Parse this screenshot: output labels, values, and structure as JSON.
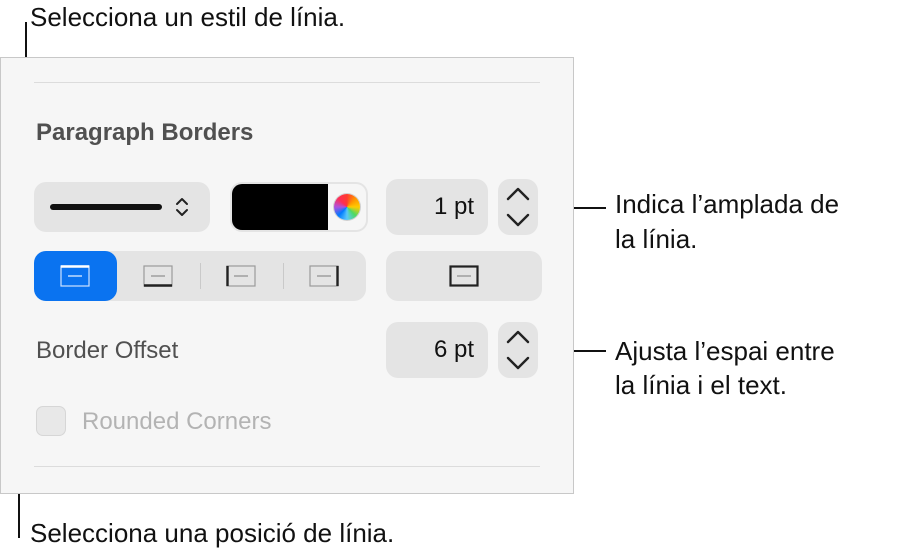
{
  "callouts": {
    "top": "Selecciona un estil de línia.",
    "width_line1": "Indica l’amplada de",
    "width_line2": "la línia.",
    "offset_line1": "Ajusta l’espai entre",
    "offset_line2": "la línia i el text.",
    "bottom": "Selecciona una posició de línia."
  },
  "panel": {
    "section_title": "Paragraph Borders",
    "line_style": {
      "selected": "solid",
      "icon": "chevron-up-down-icon"
    },
    "color": {
      "value": "#000000",
      "icon": "color-wheel-icon"
    },
    "width_field": {
      "value": "1 pt"
    },
    "position_segments": [
      {
        "name": "top",
        "active": true
      },
      {
        "name": "bottom",
        "active": false
      },
      {
        "name": "left",
        "active": false
      },
      {
        "name": "right",
        "active": false
      }
    ],
    "all_sides": {
      "name": "all-sides"
    },
    "offset_label": "Border Offset",
    "offset_field": {
      "value": "6 pt"
    },
    "rounded_corners": {
      "label": "Rounded Corners",
      "checked": false,
      "enabled": false
    }
  },
  "colors": {
    "accent": "#0a73f0",
    "panel_bg": "#f6f6f6",
    "control_bg": "#e4e4e4"
  }
}
